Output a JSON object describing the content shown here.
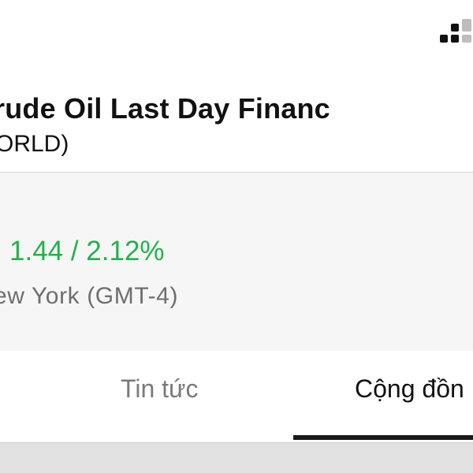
{
  "status_bar": {
    "icon": "signal-bars-icon"
  },
  "header": {
    "title": "rude Oil Last Day Financ",
    "exchange": "ORLD)"
  },
  "quote": {
    "change": "1.44 / 2.12%",
    "change_color": "#22b24c",
    "timezone": "ew York (GMT-4)"
  },
  "tabs": {
    "items": [
      {
        "label": "Tin tức",
        "active": false
      },
      {
        "label": "Cộng đồn",
        "active": true
      }
    ],
    "indicator_color": "#1a1a1a"
  }
}
